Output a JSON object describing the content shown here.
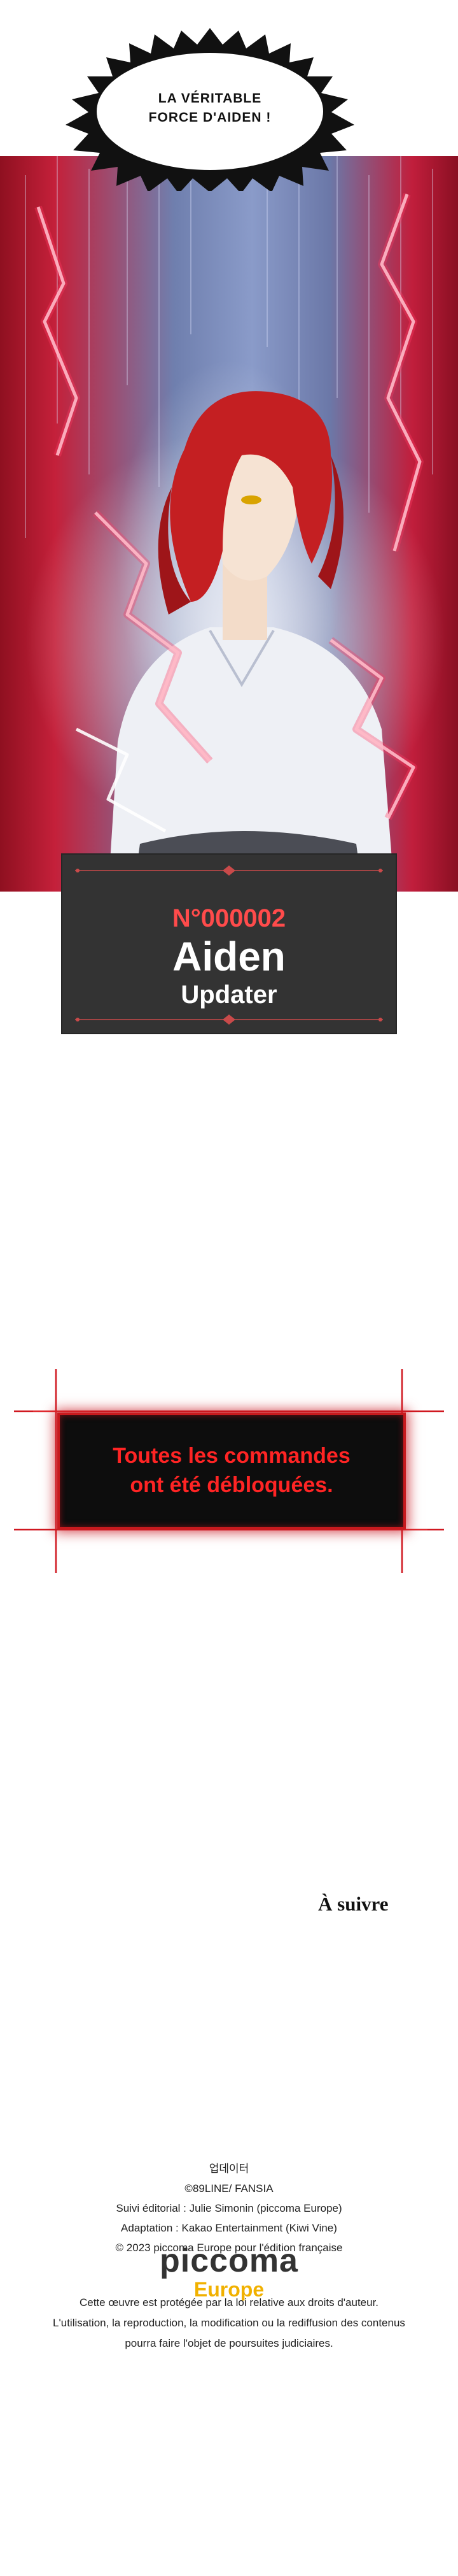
{
  "speech": {
    "text": "LA VÉRITABLE FORCE D'AIDEN !"
  },
  "status_card": {
    "number": "N°000002",
    "name": "Aiden",
    "class": "Updater"
  },
  "system_message": {
    "text": "Toutes les commandes ont été débloquées."
  },
  "to_be_continued": "À suivre",
  "credits": {
    "lines": [
      "업데이터",
      "©89LINE/ FANSIA",
      "Suivi éditorial : Julie Simonin (piccoma Europe)",
      "Adaptation : Kakao Entertainment (Kiwi Vine)",
      "© 2023 piccoma Europe pour l'édition française"
    ]
  },
  "logo": {
    "name": "piccoma",
    "region": "Europe"
  },
  "legal": {
    "lines": [
      "Cette œuvre est protégée par la loi relative aux droits d'auteur.",
      "L'utilisation, la reproduction, la modification ou la rediffusion des contenus",
      "pourra faire l'objet de poursuites judiciaires."
    ]
  },
  "colors": {
    "system_red": "#ff2424",
    "card_bg": "#333333",
    "card_number": "#ff4b4b",
    "logo_accent": "#f1b100"
  }
}
